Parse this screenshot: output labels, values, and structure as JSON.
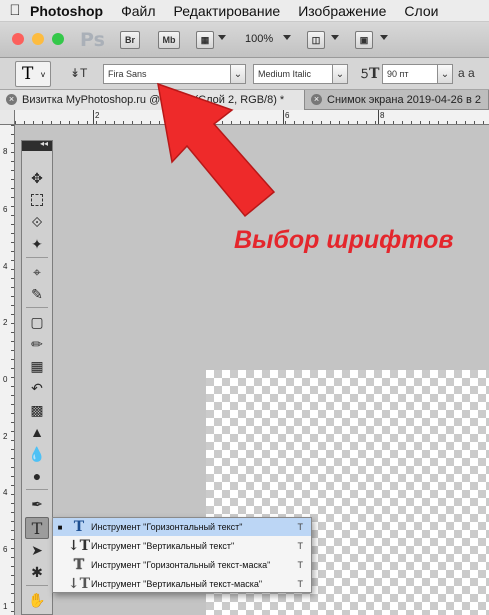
{
  "menubar": {
    "app_name": "Photoshop",
    "items": [
      "Файл",
      "Редактирование",
      "Изображение",
      "Слои"
    ]
  },
  "appbar": {
    "logo": "Ps",
    "bridge_label": "Br",
    "minibridge_label": "Mb",
    "zoom": "100%"
  },
  "options": {
    "tool_glyph": "T",
    "font_family": "Fira Sans",
    "font_style": "Medium Italic",
    "font_size": "90 пт",
    "aa_label": "a a"
  },
  "tabs": [
    {
      "title": "Визитка MyPhotoshop.ru @ 100% (Слой 2, RGB/8) *"
    },
    {
      "title": "Снимок экрана 2019-04-26 в 2"
    }
  ],
  "rulers": {
    "h_labels": [
      "2",
      "4",
      "6",
      "8"
    ],
    "v_labels": [
      "8",
      "6",
      "4",
      "2",
      "0",
      "2",
      "4",
      "6",
      "8",
      "1"
    ]
  },
  "annotation": {
    "text": "Выбор шрифтов",
    "color": "#e4262c"
  },
  "flyout": {
    "items": [
      {
        "label": "Инструмент \"Горизонтальный текст\"",
        "key": "T",
        "selected": true
      },
      {
        "label": "Инструмент \"Вертикальный текст\"",
        "key": "T",
        "selected": false
      },
      {
        "label": "Инструмент \"Горизонтальный текст-маска\"",
        "key": "T",
        "selected": false
      },
      {
        "label": "Инструмент \"Вертикальный текст-маска\"",
        "key": "T",
        "selected": false
      }
    ]
  },
  "icons": [
    "apple-icon",
    "move-icon",
    "marquee-icon",
    "lasso-icon",
    "magic-wand-icon",
    "crop-icon",
    "eyedropper-icon",
    "healing-brush-icon",
    "brush-icon",
    "stamp-icon",
    "history-brush-icon",
    "eraser-icon",
    "paint-bucket-icon",
    "blur-icon",
    "dodge-icon",
    "pen-icon",
    "type-icon",
    "path-select-icon",
    "shape-icon",
    "hand-icon"
  ]
}
